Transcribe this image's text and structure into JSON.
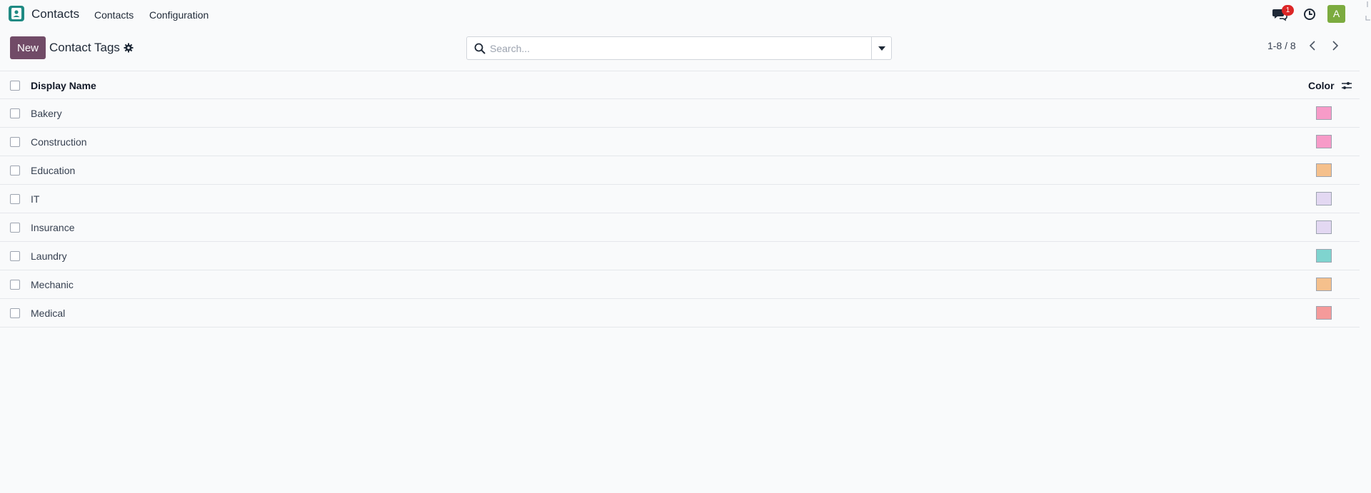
{
  "navbar": {
    "app_name": "Contacts",
    "menu": [
      "Contacts",
      "Configuration"
    ],
    "chat_badge": "1",
    "avatar_letter": "A"
  },
  "control_panel": {
    "new_label": "New",
    "title": "Contact Tags",
    "search_placeholder": "Search...",
    "pager": "1-8 / 8"
  },
  "list": {
    "columns": {
      "name": "Display Name",
      "color": "Color"
    },
    "rows": [
      {
        "name": "Bakery",
        "color": "#f79bc8"
      },
      {
        "name": "Construction",
        "color": "#f79bc8"
      },
      {
        "name": "Education",
        "color": "#f5c08c"
      },
      {
        "name": "IT",
        "color": "#e3d8f2"
      },
      {
        "name": "Insurance",
        "color": "#e3d8f2"
      },
      {
        "name": "Laundry",
        "color": "#7fd4cf"
      },
      {
        "name": "Mechanic",
        "color": "#f5c08c"
      },
      {
        "name": "Medical",
        "color": "#f59a9a"
      }
    ]
  },
  "colors": {
    "primary": "#714b67",
    "badge": "#dc2626",
    "avatar": "#7cab3f",
    "app_logo": "#1f8a83"
  },
  "icons": [
    "contacts-app-icon",
    "chat-icon",
    "clock-icon",
    "gear-icon",
    "search-icon",
    "caret-down-icon",
    "chevron-left-icon",
    "chevron-right-icon",
    "optional-columns-icon"
  ]
}
